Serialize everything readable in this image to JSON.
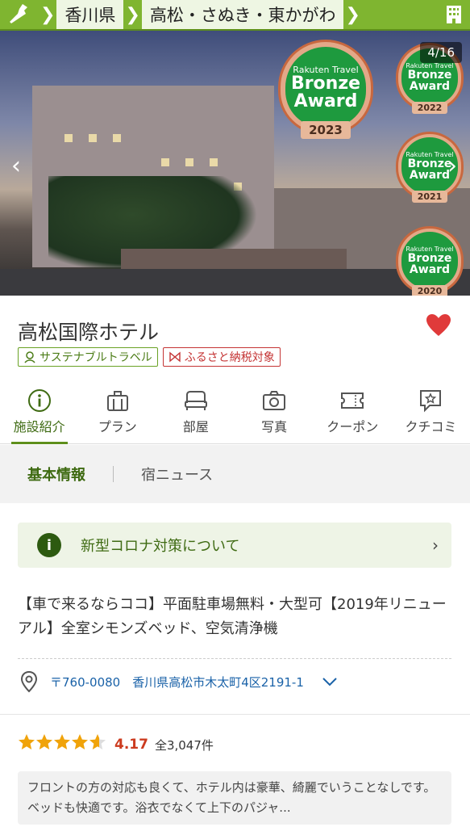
{
  "breadcrumb": {
    "items": [
      "香川県",
      "高松・さぬき・東かがわ"
    ]
  },
  "gallery": {
    "counter": "4/16"
  },
  "awards": [
    {
      "brand": "Rakuten Travel",
      "name": "Bronze Award",
      "year": "2023"
    },
    {
      "brand": "Rakuten Travel",
      "name": "Bronze Award",
      "year": "2022"
    },
    {
      "brand": "Rakuten Travel",
      "name": "Bronze Award",
      "year": "2021"
    },
    {
      "brand": "Rakuten Travel",
      "name": "Bronze Award",
      "year": "2020"
    }
  ],
  "hotel": {
    "name": "高松国際ホテル",
    "sign": "高松国際ホテル"
  },
  "tags": {
    "sustainable": "サステナブルトラベル",
    "furusato": "ふるさと納税対象"
  },
  "tabs": [
    {
      "label": "施設紹介",
      "icon": "info-icon"
    },
    {
      "label": "プラン",
      "icon": "suitcase-icon"
    },
    {
      "label": "部屋",
      "icon": "bed-icon"
    },
    {
      "label": "写真",
      "icon": "camera-icon"
    },
    {
      "label": "クーポン",
      "icon": "ticket-icon"
    },
    {
      "label": "クチコミ",
      "icon": "review-icon"
    }
  ],
  "subtabs": {
    "basic": "基本情報",
    "news": "宿ニュース"
  },
  "corona": {
    "label": "新型コロナ対策について"
  },
  "catchcopy": "【車で来るならココ】平面駐車場無料・大型可【2019年リニューアル】全室シモンズベッド、空気清浄機",
  "address": {
    "text": "〒760-0080　香川県高松市木太町4区2191-1"
  },
  "rating": {
    "score": "4.17",
    "stars": 4.17,
    "count": "全3,047件"
  },
  "review": {
    "text": "フロントの方の対応も良くて、ホテル内は豪華、綺麗でいうことなしです。ベッドも快適です。浴衣でなくて上下のパジャ..."
  },
  "colors": {
    "brand_green": "#7fb530",
    "active_green": "#3f6b13",
    "heart_red": "#e03a3a",
    "score_red": "#cc3b1f",
    "link_blue": "#1a62a8"
  }
}
